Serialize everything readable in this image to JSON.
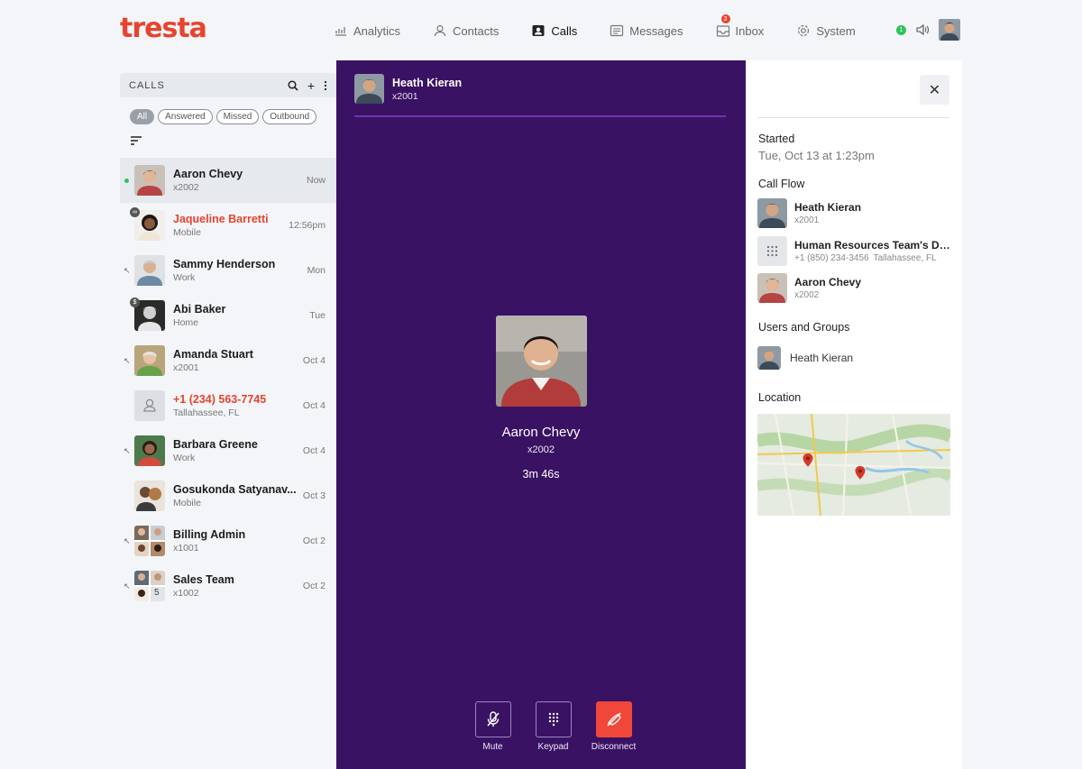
{
  "brand": {
    "logo_text": "tresta",
    "accent": "#e8432e"
  },
  "nav": {
    "analytics": "Analytics",
    "contacts": "Contacts",
    "calls": "Calls",
    "messages": "Messages",
    "inbox": "Inbox",
    "inbox_badge": "3",
    "system": "System",
    "status_badge": "1"
  },
  "calls_panel": {
    "title": "CALLS",
    "filters": [
      "All",
      "Answered",
      "Missed",
      "Outbound"
    ],
    "rows": [
      {
        "name": "Aaron Chevy",
        "sub": "x2002",
        "time": "Now"
      },
      {
        "name": "Jaqueline Barretti",
        "sub": "Mobile",
        "time": "12:56pm",
        "badge": "∞"
      },
      {
        "name": "Sammy Henderson",
        "sub": "Work",
        "time": "Mon"
      },
      {
        "name": "Abi Baker",
        "sub": "Home",
        "time": "Tue",
        "badge": "$"
      },
      {
        "name": "Amanda Stuart",
        "sub": "x2001",
        "time": "Oct 4"
      },
      {
        "name": "+1 (234) 563-7745",
        "sub": "Tallahassee, FL",
        "time": "Oct 4"
      },
      {
        "name": "Barbara Greene",
        "sub": "Work",
        "time": "Oct 4"
      },
      {
        "name": "Gosukonda Satyanav...",
        "sub": "Mobile",
        "time": "Oct 3"
      },
      {
        "name": "Billing Admin",
        "sub": "x1001",
        "time": "Oct 2"
      },
      {
        "name": "Sales Team",
        "sub": "x1002",
        "time": "Oct 2",
        "count": "5"
      }
    ]
  },
  "call": {
    "agent_name": "Heath Kieran",
    "agent_ext": "x2001",
    "caller_name": "Aaron Chevy",
    "caller_ext": "x2002",
    "duration": "3m 46s",
    "controls": {
      "mute": "Mute",
      "keypad": "Keypad",
      "disconnect": "Disconnect"
    }
  },
  "details": {
    "started_label": "Started",
    "started_value": "Tue, Oct 13 at 1:23pm",
    "call_flow_label": "Call Flow",
    "flow": [
      {
        "name": "Heath Kieran",
        "sub": "x2001"
      },
      {
        "name": "Human Resources Team's Dir...",
        "sub": "+1 (850) 234-3456",
        "sub2": "Tallahassee, FL"
      },
      {
        "name": "Aaron Chevy",
        "sub": "x2002"
      }
    ],
    "users_groups_label": "Users and Groups",
    "user": "Heath Kieran",
    "location_label": "Location"
  }
}
